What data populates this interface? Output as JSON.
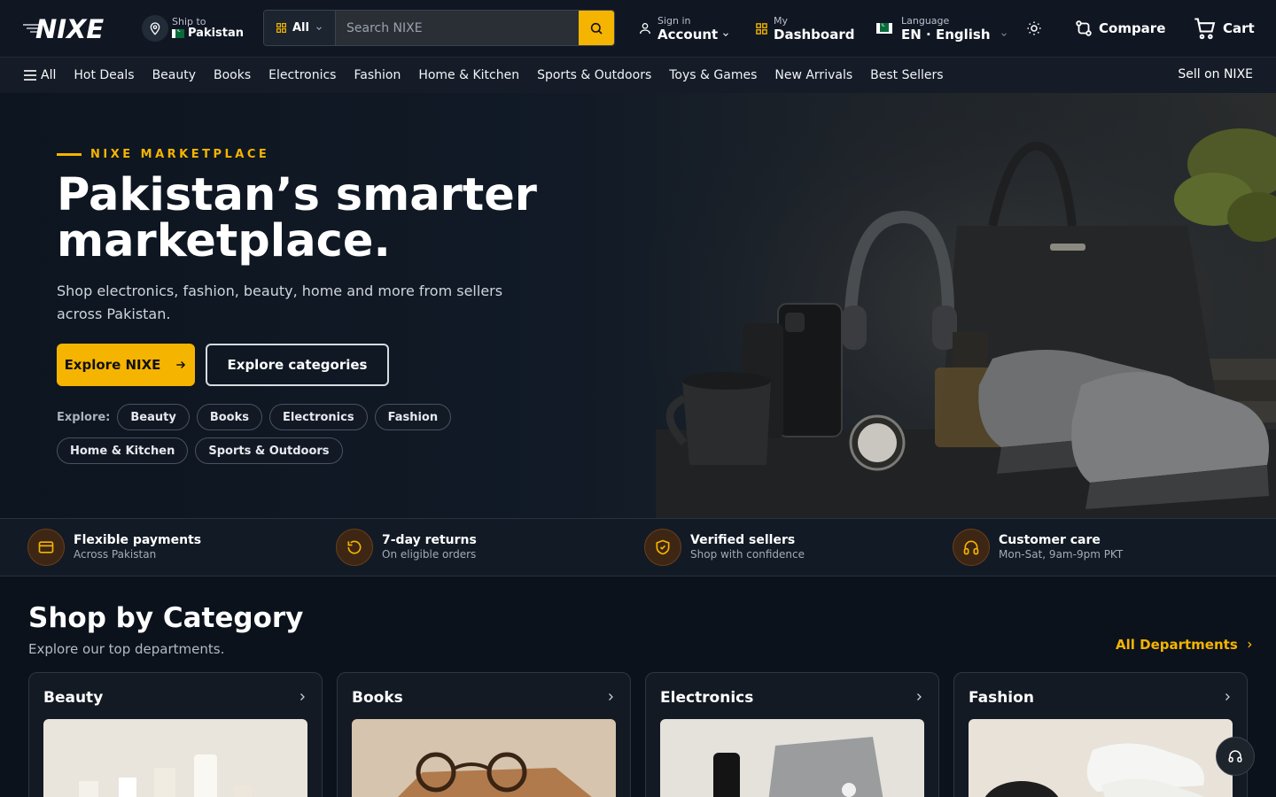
{
  "brand": {
    "name": "NIXE"
  },
  "header": {
    "ship_to_label": "Ship to",
    "ship_to_value": "Pakistan",
    "search_category": "All",
    "search_placeholder": "Search NIXE",
    "account_small": "Sign in",
    "account_big": "Account",
    "dashboard_small": "My",
    "dashboard_big": "Dashboard",
    "language_small": "Language",
    "language_big": "EN · English",
    "compare": "Compare",
    "cart": "Cart"
  },
  "nav": {
    "all": "All",
    "links": [
      "Hot Deals",
      "Beauty",
      "Books",
      "Electronics",
      "Fashion",
      "Home & Kitchen",
      "Sports & Outdoors",
      "Toys & Games",
      "New Arrivals",
      "Best Sellers"
    ],
    "sell": "Sell on NIXE"
  },
  "hero": {
    "eyebrow": "NIXE MARKETPLACE",
    "title": "Pakistan’s smarter marketplace.",
    "subtitle": "Shop electronics, fashion, beauty, home and more from sellers across Pakistan.",
    "primary_cta": "Explore NIXE",
    "secondary_cta": "Explore categories",
    "chips_label": "Explore:",
    "chips": [
      "Beauty",
      "Books",
      "Electronics",
      "Fashion",
      "Home & Kitchen",
      "Sports & Outdoors"
    ]
  },
  "features": [
    {
      "title": "Flexible payments",
      "subtitle": "Across Pakistan",
      "icon": "card-icon"
    },
    {
      "title": "7-day returns",
      "subtitle": "On eligible orders",
      "icon": "return-icon"
    },
    {
      "title": "Verified sellers",
      "subtitle": "Shop with confidence",
      "icon": "shield-icon"
    },
    {
      "title": "Customer care",
      "subtitle": "Mon-Sat, 9am-9pm PKT",
      "icon": "headset-icon"
    }
  ],
  "categories_section": {
    "title": "Shop by Category",
    "subtitle": "Explore our top departments.",
    "all_link": "All Departments",
    "cards": [
      "Beauty",
      "Books",
      "Electronics",
      "Fashion"
    ]
  },
  "colors": {
    "accent": "#f5b400",
    "background": "#0b121c",
    "header": "#101723"
  }
}
